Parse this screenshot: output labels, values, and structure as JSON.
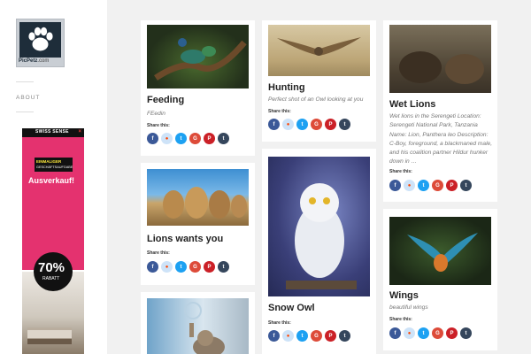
{
  "site": {
    "logo_name": "PicPetz",
    "logo_suffix": ".com"
  },
  "nav": {
    "about": "ABOUT"
  },
  "ad": {
    "brand": "SWISS SENSE",
    "brand_mark": "×",
    "tag1": "EINMALIGER",
    "tag2": "GESCHÄFTSAUFGABE",
    "headline": "Ausverkauf!",
    "percent": "70%",
    "discount": "RABATT"
  },
  "share": {
    "label": "Share this:",
    "icons": [
      {
        "name": "facebook-icon",
        "glyph": "f",
        "color": "#3b5998"
      },
      {
        "name": "reddit-icon",
        "glyph": "●",
        "color": "#cee3f8",
        "glyph_color": "#ff4500"
      },
      {
        "name": "twitter-icon",
        "glyph": "t",
        "color": "#1da1f2"
      },
      {
        "name": "google-plus-icon",
        "glyph": "G",
        "color": "#dd4b39"
      },
      {
        "name": "pinterest-icon",
        "glyph": "P",
        "color": "#cb2027"
      },
      {
        "name": "tumblr-icon",
        "glyph": "t",
        "color": "#35465c"
      }
    ]
  },
  "cards": [
    {
      "id": "feeding",
      "title": "Feeding",
      "desc": "FEedin"
    },
    {
      "id": "hunting",
      "title": "Hunting",
      "desc": "Perfect shot of an Owl looking at you"
    },
    {
      "id": "wet-lions",
      "title": "Wet Lions",
      "desc": "Wet lions in the Serengeti Location: Serengeti National Park, Tanzania Name: Lion, Panthera leo Description: C-Boy, foreground, a blackmaned male, and his coalition partner Hildur hunker down in …"
    },
    {
      "id": "lions-wants-you",
      "title": "Lions wants you",
      "desc": ""
    },
    {
      "id": "snow-owl",
      "title": "Snow Owl",
      "desc": ""
    },
    {
      "id": "wings",
      "title": "Wings",
      "desc": "beautiful wings"
    },
    {
      "id": "cat-bubble",
      "title": "",
      "desc": ""
    }
  ]
}
